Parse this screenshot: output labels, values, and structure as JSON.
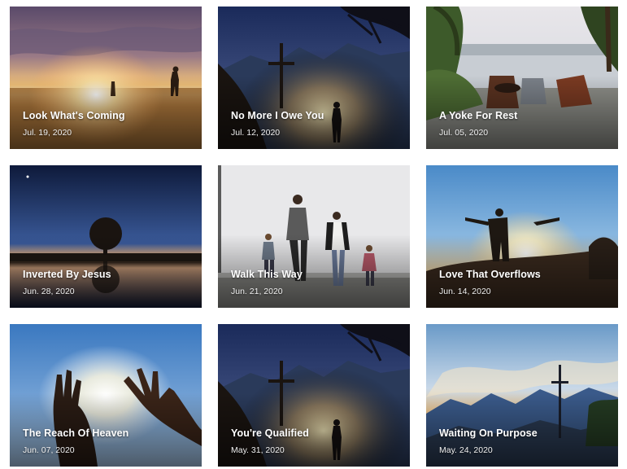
{
  "sermons": [
    {
      "title": "Look What's Coming",
      "date": "Jul. 19, 2020"
    },
    {
      "title": "No More I Owe You",
      "date": "Jul. 12, 2020"
    },
    {
      "title": "A Yoke For Rest",
      "date": "Jul. 05, 2020"
    },
    {
      "title": "Inverted By Jesus",
      "date": "Jun. 28, 2020"
    },
    {
      "title": "Walk This Way",
      "date": "Jun. 21, 2020"
    },
    {
      "title": "Love That Overflows",
      "date": "Jun. 14, 2020"
    },
    {
      "title": "The Reach Of Heaven",
      "date": "Jun. 07, 2020"
    },
    {
      "title": "You're Qualified",
      "date": "May. 31, 2020"
    },
    {
      "title": "Waiting On Purpose",
      "date": "May. 24, 2020"
    }
  ]
}
